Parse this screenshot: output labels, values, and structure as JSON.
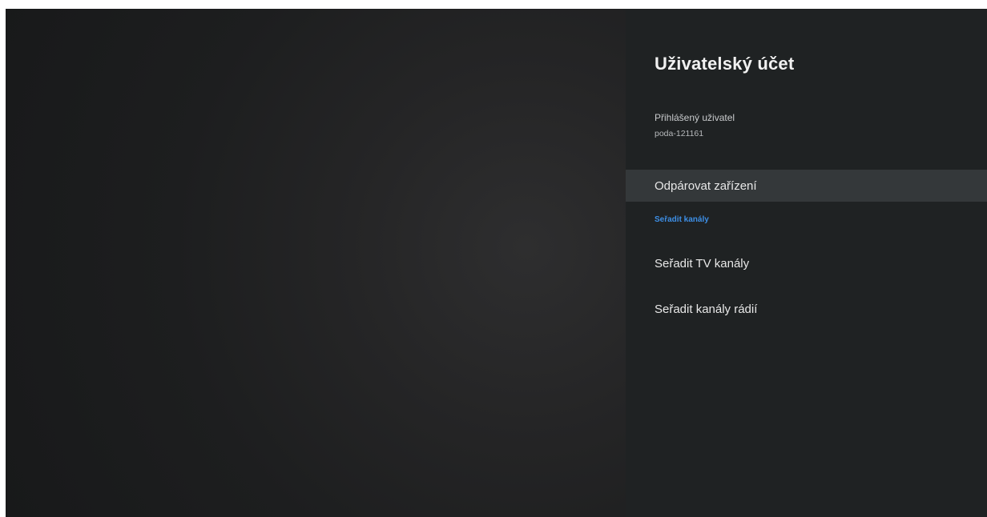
{
  "panel": {
    "title": "Uživatelský účet",
    "account": {
      "label": "Přihlášený uživatel",
      "value": "poda-121161"
    },
    "items": [
      {
        "label": "Odpárovat zařízení",
        "focused": true
      }
    ],
    "section": {
      "header": "Seřadit kanály",
      "items": [
        {
          "label": "Seřadit TV kanály"
        },
        {
          "label": "Seřadit kanály rádií"
        }
      ]
    }
  },
  "colors": {
    "panel_background": "#1f2223",
    "focused_item_background": "#34383a",
    "section_header": "#3d8fe6"
  }
}
